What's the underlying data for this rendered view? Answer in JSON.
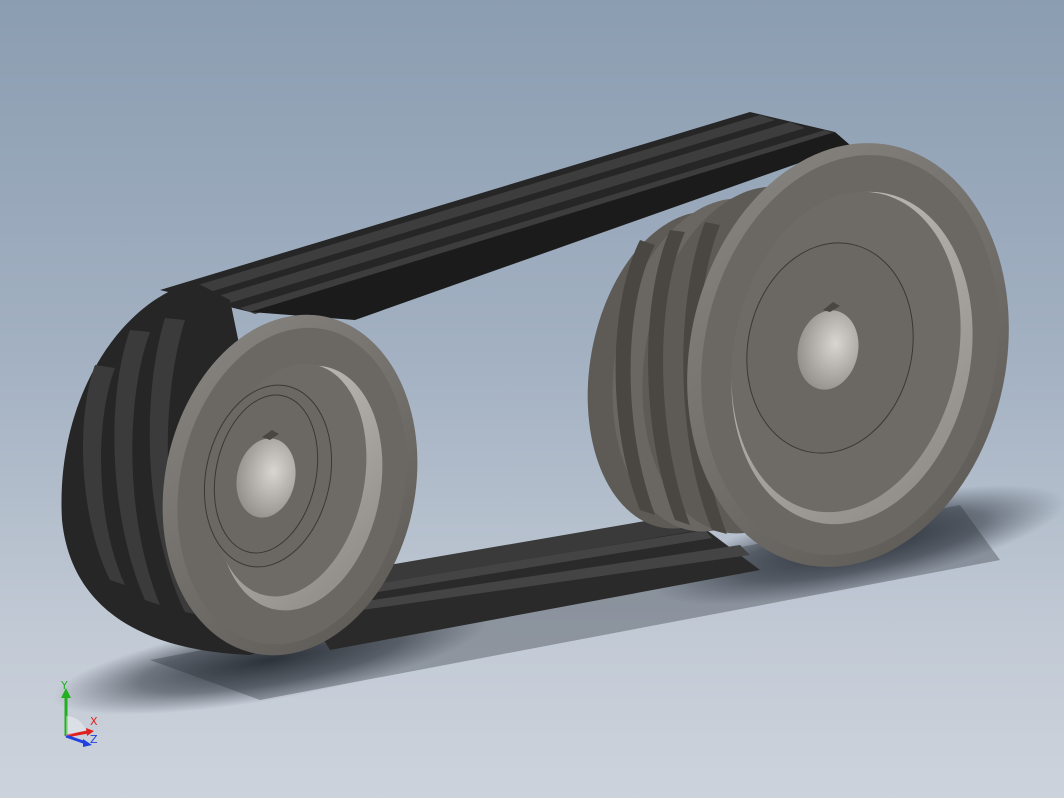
{
  "viewport": {
    "background_top": "#8b9db1",
    "background_bottom": "#cdd3dc"
  },
  "model": {
    "belt_color": "#2b2b2b",
    "pulley_color": "#6d6a66",
    "pulley_face_color": "#7a7773",
    "pulley_highlight": "#b9b6b1"
  },
  "triad": {
    "x_label": "X",
    "y_label": "Y",
    "z_label": "Z",
    "x_color": "#e02020",
    "y_color": "#20b020",
    "z_color": "#2040e0"
  }
}
